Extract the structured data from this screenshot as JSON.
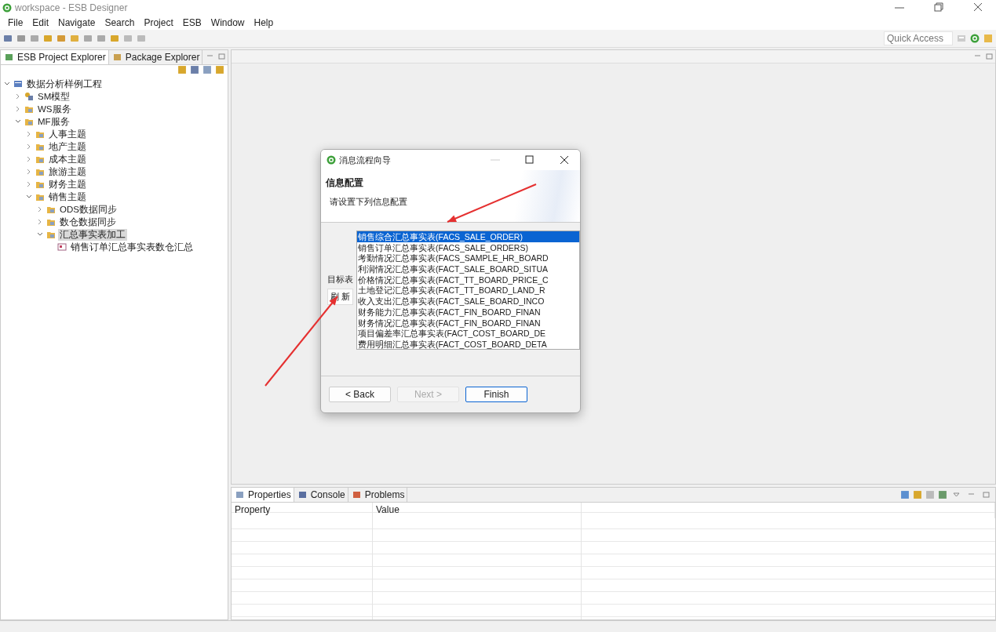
{
  "window": {
    "title": "workspace - ESB Designer"
  },
  "menu": [
    "File",
    "Edit",
    "Navigate",
    "Search",
    "Project",
    "ESB",
    "Window",
    "Help"
  ],
  "quick_access": {
    "placeholder": "Quick Access"
  },
  "explorer": {
    "tabs": [
      {
        "label": "ESB Project Explorer",
        "selected": true
      },
      {
        "label": "Package Explorer",
        "selected": false
      }
    ],
    "tree": [
      {
        "label": "数据分析样例工程",
        "kind": "project",
        "expanded": true,
        "selected": false,
        "children": [
          {
            "label": "SM模型",
            "kind": "model",
            "expanded": false,
            "selected": false
          },
          {
            "label": "WS服务",
            "kind": "folder",
            "expanded": false,
            "selected": false
          },
          {
            "label": "MF服务",
            "kind": "folder",
            "expanded": true,
            "selected": false,
            "children": [
              {
                "label": "人事主题",
                "kind": "folder",
                "expanded": false,
                "selected": false
              },
              {
                "label": "地产主题",
                "kind": "folder",
                "expanded": false,
                "selected": false
              },
              {
                "label": "成本主题",
                "kind": "folder",
                "expanded": false,
                "selected": false
              },
              {
                "label": "旅游主题",
                "kind": "folder",
                "expanded": false,
                "selected": false
              },
              {
                "label": "财务主题",
                "kind": "folder",
                "expanded": false,
                "selected": false
              },
              {
                "label": "销售主题",
                "kind": "folder",
                "expanded": true,
                "selected": false,
                "children": [
                  {
                    "label": "ODS数据同步",
                    "kind": "folder",
                    "expanded": false,
                    "selected": false
                  },
                  {
                    "label": "数仓数据同步",
                    "kind": "folder",
                    "expanded": false,
                    "selected": false
                  },
                  {
                    "label": "汇总事实表加工",
                    "kind": "folder",
                    "expanded": true,
                    "selected": true,
                    "children": [
                      {
                        "label": "销售订单汇总事实表数仓汇总",
                        "kind": "flow",
                        "selected": false
                      }
                    ]
                  }
                ]
              }
            ]
          }
        ]
      }
    ]
  },
  "dialog": {
    "title": "消息流程向导",
    "heading": "信息配置",
    "description": "请设置下列信息配置",
    "field_label": "目标表",
    "refresh_button": "刷 新",
    "items": [
      {
        "label": "销售综合汇总事实表(FACS_SALE_ORDER)",
        "selected": true
      },
      {
        "label": "销售订单汇总事实表(FACS_SALE_ORDERS)",
        "selected": false
      },
      {
        "label": "考勤情况汇总事实表(FACS_SAMPLE_HR_BOARD",
        "selected": false
      },
      {
        "label": "利润情况汇总事实表(FACT_SALE_BOARD_SITUA",
        "selected": false
      },
      {
        "label": "价格情况汇总事实表(FACT_TT_BOARD_PRICE_C",
        "selected": false
      },
      {
        "label": "土地登记汇总事实表(FACT_TT_BOARD_LAND_R",
        "selected": false
      },
      {
        "label": "收入支出汇总事实表(FACT_SALE_BOARD_INCO",
        "selected": false
      },
      {
        "label": "财务能力汇总事实表(FACT_FIN_BOARD_FINAN",
        "selected": false
      },
      {
        "label": "财务情况汇总事实表(FACT_FIN_BOARD_FINAN",
        "selected": false
      },
      {
        "label": "项目偏差率汇总事实表(FACT_COST_BOARD_DE",
        "selected": false
      },
      {
        "label": "费用明细汇总事实表(FACT_COST_BOARD_DETA",
        "selected": false
      }
    ],
    "buttons": [
      {
        "label": "< Back",
        "disabled": false,
        "default": false
      },
      {
        "label": "Next >",
        "disabled": true,
        "default": false
      },
      {
        "label": "Finish",
        "disabled": false,
        "default": true
      }
    ]
  },
  "bottom_panel": {
    "tabs": [
      {
        "label": "Properties",
        "selected": true
      },
      {
        "label": "Console",
        "selected": false
      },
      {
        "label": "Problems",
        "selected": false
      }
    ],
    "columns": [
      "Property",
      "Value"
    ]
  }
}
